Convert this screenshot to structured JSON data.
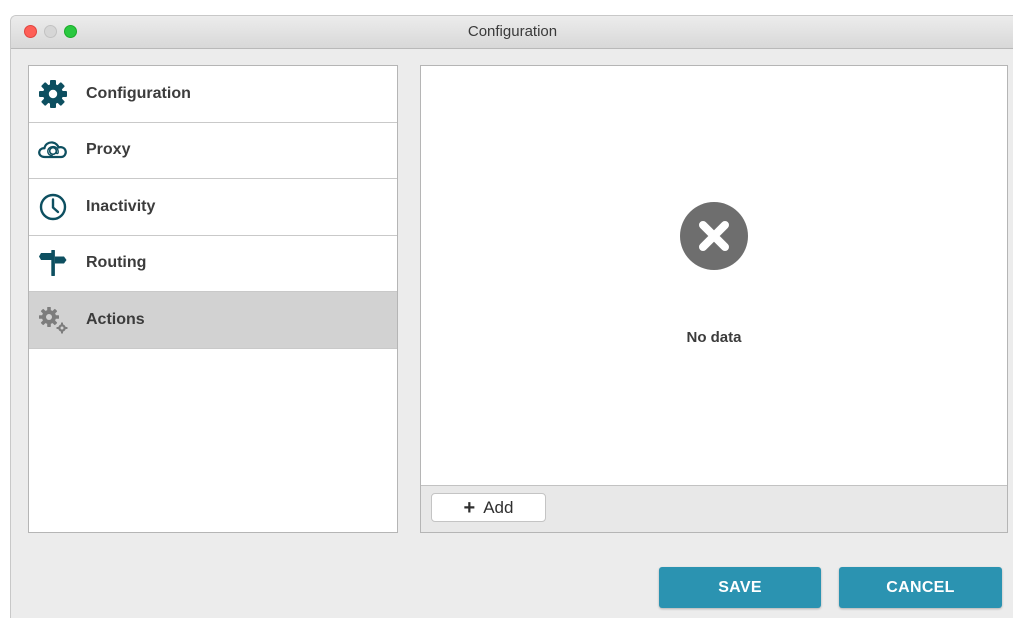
{
  "window": {
    "title": "Configuration"
  },
  "sidebar": {
    "items": [
      {
        "label": "Configuration",
        "icon": "gear-icon",
        "selected": false
      },
      {
        "label": "Proxy",
        "icon": "cloud-at-icon",
        "selected": false
      },
      {
        "label": "Inactivity",
        "icon": "clock-icon",
        "selected": false
      },
      {
        "label": "Routing",
        "icon": "signpost-icon",
        "selected": false
      },
      {
        "label": "Actions",
        "icon": "gears-icon",
        "selected": true
      }
    ]
  },
  "main": {
    "empty_icon": "error-x-icon",
    "empty_text": "No data",
    "add_label": "Add"
  },
  "footer": {
    "save_label": "SAVE",
    "cancel_label": "CANCEL"
  },
  "colors": {
    "accent": "#2b93b1",
    "icon": "#0d4f60",
    "selected_row": "#d2d2d2",
    "empty_icon": "#6e6e6e"
  }
}
